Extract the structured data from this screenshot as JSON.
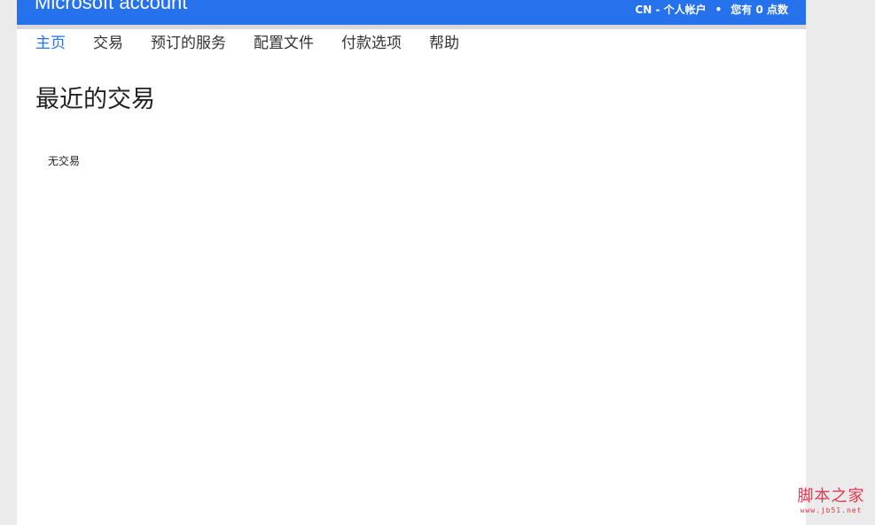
{
  "header": {
    "brand": "Microsoft account",
    "account_region": "CN - 个人帐户",
    "separator": "•",
    "points": "您有 0 点数",
    "color": "#2672ec"
  },
  "nav": {
    "items": [
      {
        "label": "主页",
        "active": true
      },
      {
        "label": "交易",
        "active": false
      },
      {
        "label": "预订的服务",
        "active": false
      },
      {
        "label": "配置文件",
        "active": false
      },
      {
        "label": "付款选项",
        "active": false
      },
      {
        "label": "帮助",
        "active": false
      }
    ]
  },
  "main": {
    "title": "最近的交易",
    "empty_message": "无交易"
  },
  "watermark": {
    "text": "脚本之家",
    "url": "www.jb51.net"
  }
}
